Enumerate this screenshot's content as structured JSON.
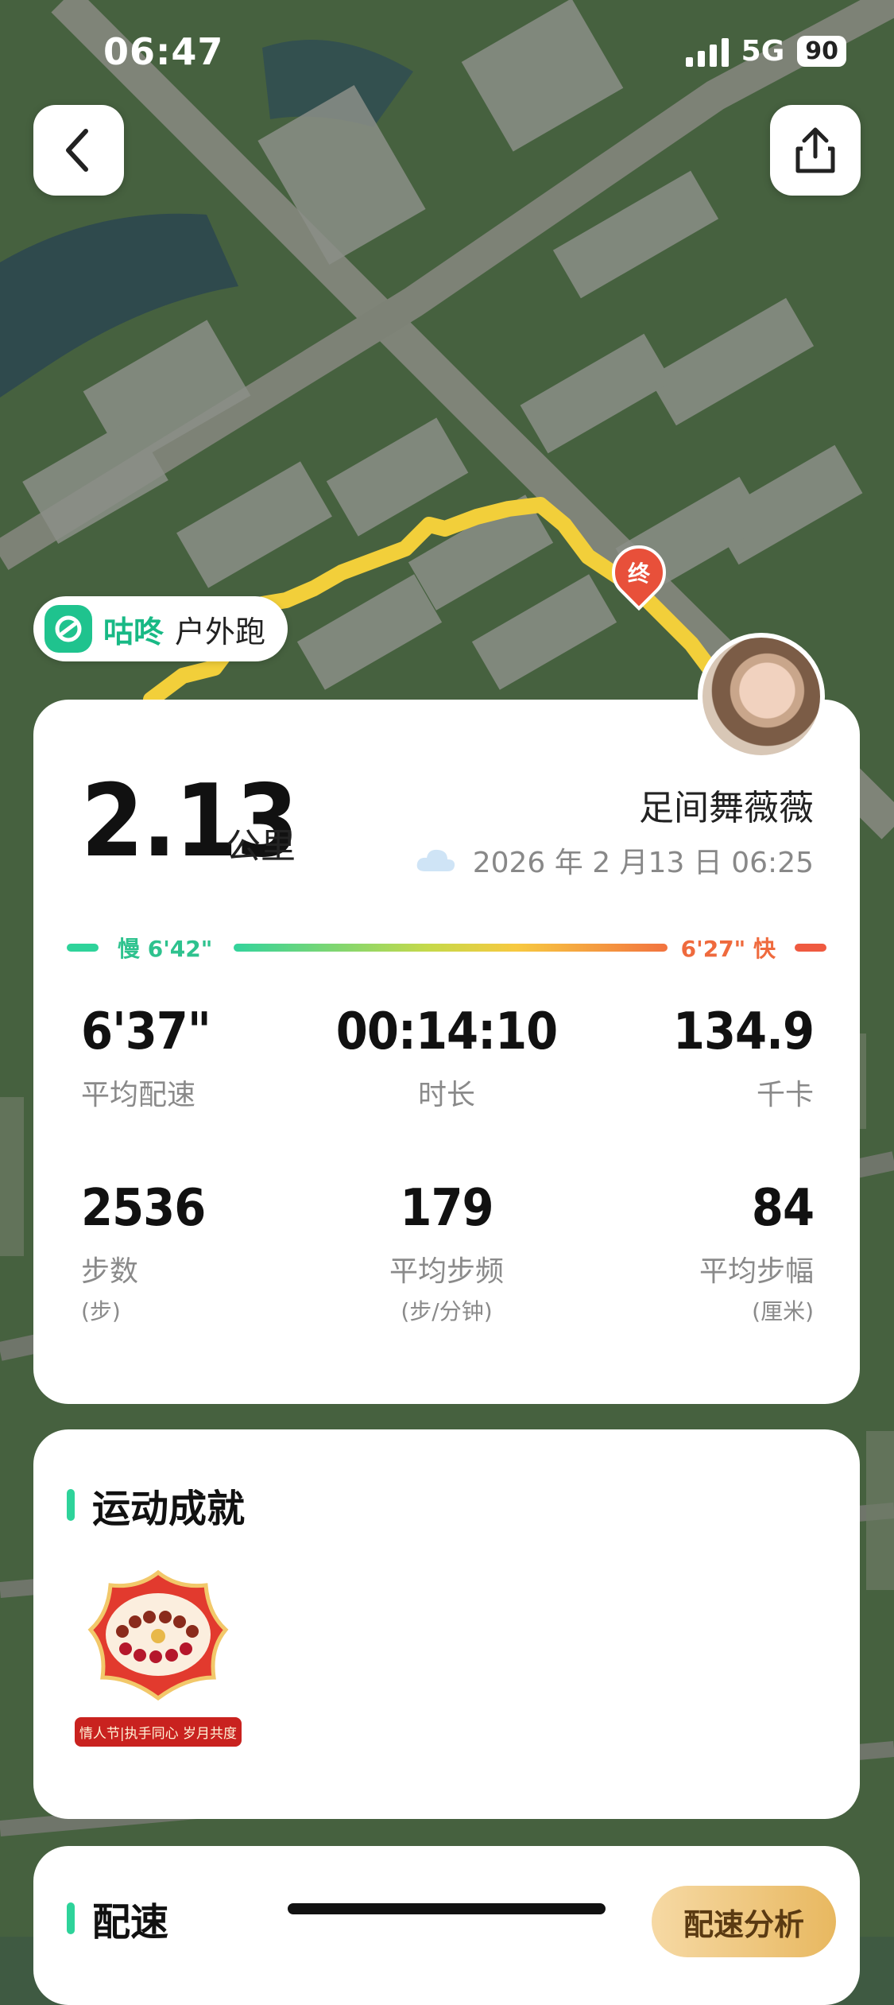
{
  "status_bar": {
    "time": "06:47",
    "network": "5G",
    "battery": "90"
  },
  "map": {
    "end_marker": "终"
  },
  "tag": {
    "brand": "咕咚",
    "type": "户外跑",
    "logo_icon": "codoon-logo-icon"
  },
  "summary": {
    "distance": "2.13",
    "distance_unit": "公里",
    "username": "足间舞薇薇",
    "weather_icon": "cloud-icon",
    "datetime": "2026 年 2 月13 日  06:25",
    "pace_slow": "慢 6'42\"",
    "pace_fast": "6'27\" 快",
    "stats": [
      {
        "value": "6'37\"",
        "label": "平均配速",
        "sub": ""
      },
      {
        "value": "00:14:10",
        "label": "时长",
        "sub": ""
      },
      {
        "value": "134.9",
        "label": "千卡",
        "sub": ""
      },
      {
        "value": "2536",
        "label": "步数",
        "sub": "(步)"
      },
      {
        "value": "179",
        "label": "平均步频",
        "sub": "(步/分钟)"
      },
      {
        "value": "84",
        "label": "平均步幅",
        "sub": "(厘米)"
      }
    ]
  },
  "achievements": {
    "title": "运动成就",
    "badge_caption": "情人节|执手同心 岁月共度"
  },
  "pace": {
    "title": "配速",
    "analysis_button": "配速分析"
  },
  "colors": {
    "accent_green": "#2ed39a",
    "brand_green": "#18b985",
    "route_yellow": "#f2cf3a",
    "end_red": "#e8503a"
  }
}
